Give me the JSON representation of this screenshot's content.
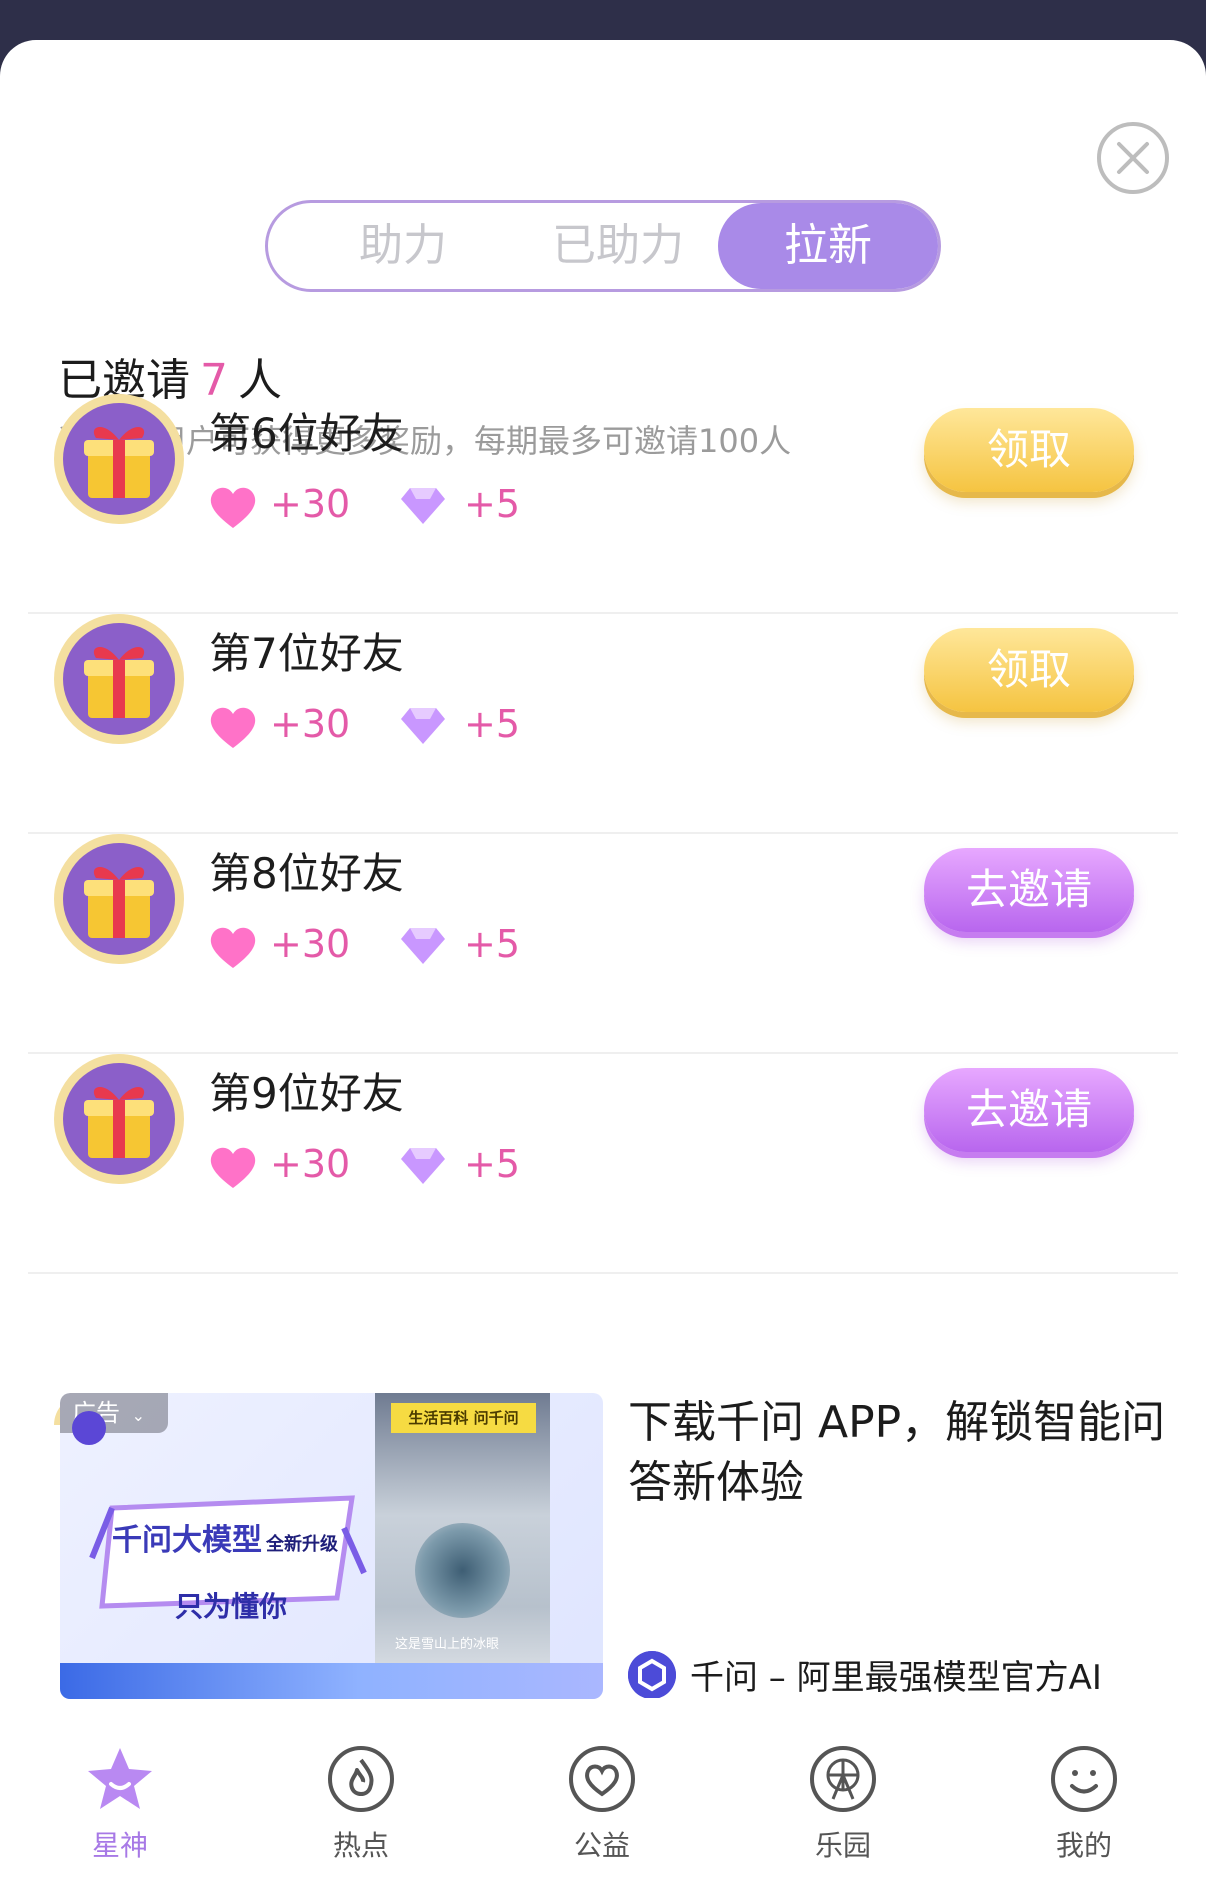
{
  "segmented": {
    "tabs": [
      {
        "label": "助力"
      },
      {
        "label": "已助力"
      },
      {
        "label": "拉新"
      }
    ],
    "active": 2
  },
  "invited": {
    "prefix": "已邀请",
    "count": "7",
    "suffix": "人",
    "subtitle": "邀请新用户可获得更多奖励，每期最多可邀请100人"
  },
  "rewards": [
    {
      "title": "第6位好友",
      "hearts": "+30",
      "diamonds": "+5",
      "button": "领取",
      "button_style": "gold"
    },
    {
      "title": "第7位好友",
      "hearts": "+30",
      "diamonds": "+5",
      "button": "领取",
      "button_style": "gold"
    },
    {
      "title": "第8位好友",
      "hearts": "+30",
      "diamonds": "+5",
      "button": "去邀请",
      "button_style": "purple"
    },
    {
      "title": "第9位好友",
      "hearts": "+30",
      "diamonds": "+5",
      "button": "去邀请",
      "button_style": "purple"
    }
  ],
  "ad": {
    "badge": "广告",
    "image_tag": "生活百科 问千问",
    "image_caption": "这是雪山上的冰眼",
    "image_headline": "千问大模型",
    "image_headline_small": "全新升级",
    "image_slogan": "只为懂你",
    "title": "下载千问 APP，解锁智能问答新体验",
    "source": "千问 – 阿里最强模型官方AI"
  },
  "tabbar": [
    {
      "label": "星神",
      "icon": "star-icon",
      "active": true
    },
    {
      "label": "热点",
      "icon": "flame-icon",
      "active": false
    },
    {
      "label": "公益",
      "icon": "heart-icon",
      "active": false
    },
    {
      "label": "乐园",
      "icon": "ferris-wheel-icon",
      "active": false
    },
    {
      "label": "我的",
      "icon": "smiley-icon",
      "active": false
    }
  ],
  "colors": {
    "accent_purple": "#a98ae8",
    "count_pink": "#e45aa8",
    "gold_button": "#f5c441",
    "purple_button": "#b866ee"
  }
}
